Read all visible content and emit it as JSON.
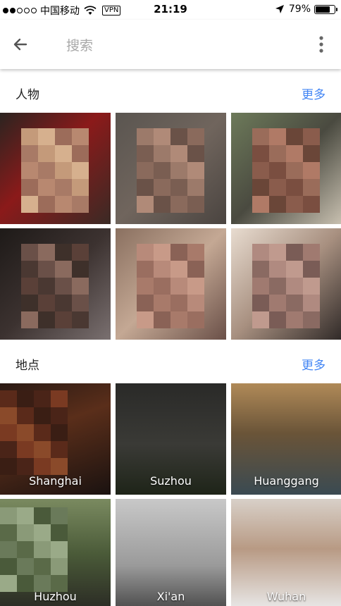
{
  "status_bar": {
    "carrier": "中国移动",
    "vpn": "VPN",
    "time": "21:19",
    "battery": "79%",
    "battery_level": 0.79
  },
  "search": {
    "placeholder": "搜索"
  },
  "people_section": {
    "title": "人物",
    "more_label": "更多",
    "tiles": [
      {
        "name": "person-1",
        "bg": "#7a4a3a"
      },
      {
        "name": "person-2",
        "bg": "#6a5a50"
      },
      {
        "name": "person-3",
        "bg": "#5d4c3e"
      },
      {
        "name": "person-4",
        "bg": "#3a3230"
      },
      {
        "name": "person-5",
        "bg": "#8a7670"
      },
      {
        "name": "person-6",
        "bg": "#a89088"
      }
    ]
  },
  "places_section": {
    "title": "地点",
    "more_label": "更多",
    "places": [
      {
        "label": "Shanghai"
      },
      {
        "label": "Suzhou"
      },
      {
        "label": "Huanggang"
      },
      {
        "label": "Huzhou"
      },
      {
        "label": "Xi'an"
      },
      {
        "label": "Wuhan"
      }
    ]
  },
  "colors": {
    "accent": "#4285f4",
    "placeholder": "#a8a8a8"
  }
}
